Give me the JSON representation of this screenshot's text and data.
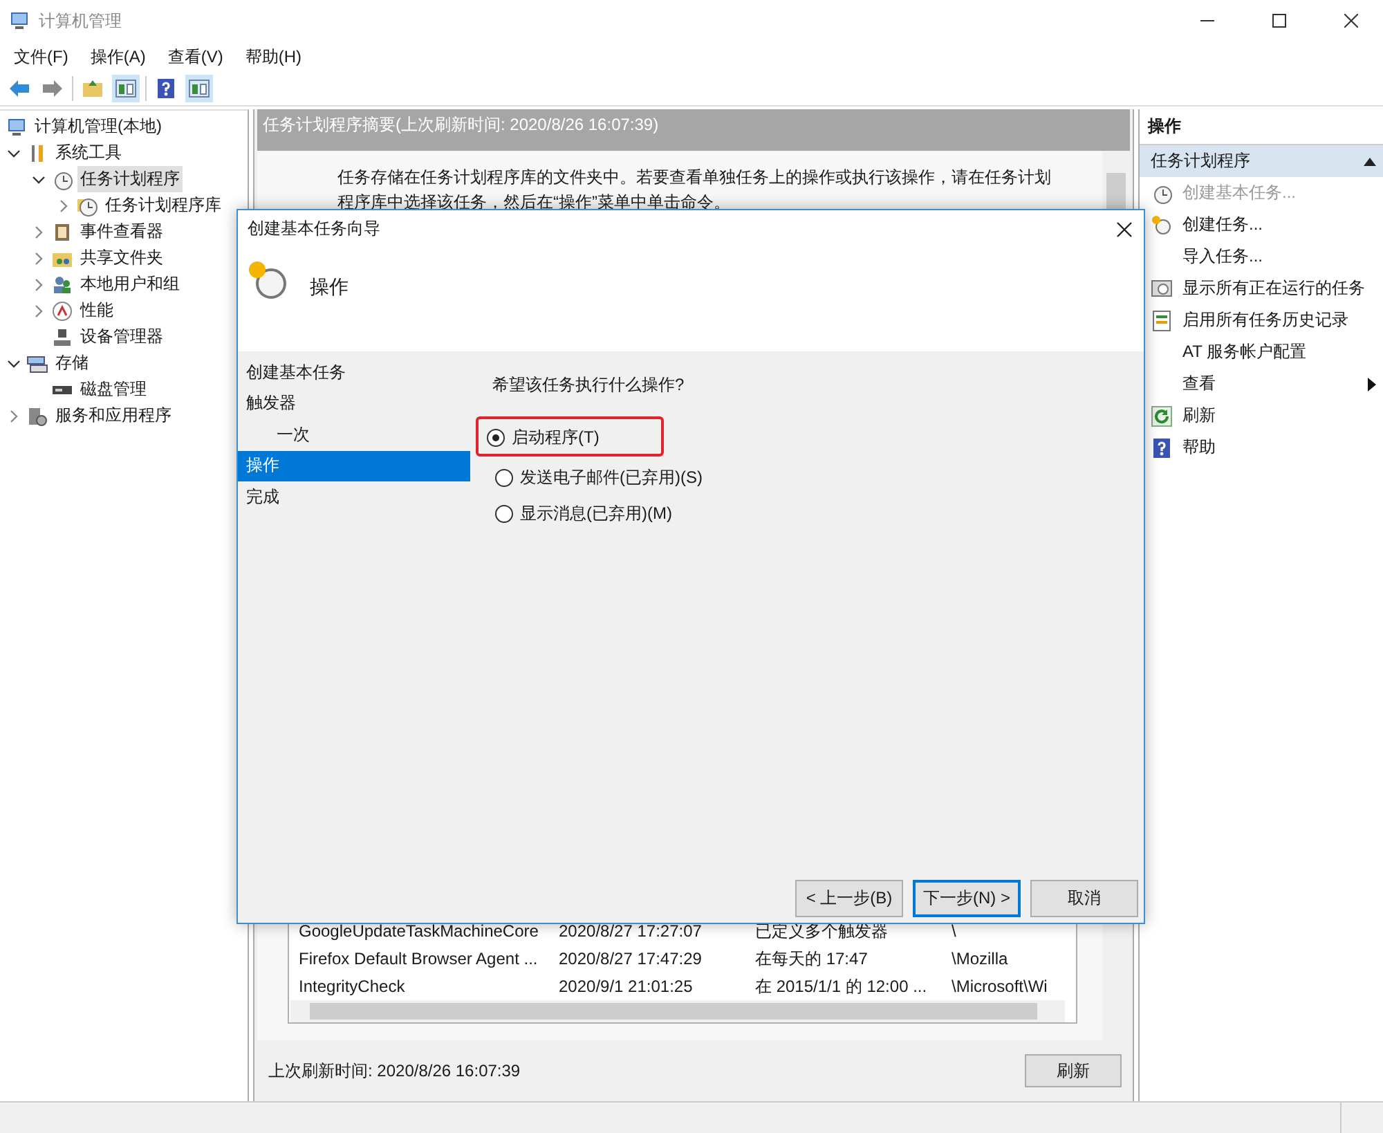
{
  "window": {
    "title": "计算机管理"
  },
  "menu": [
    "文件(F)",
    "操作(A)",
    "查看(V)",
    "帮助(H)"
  ],
  "tree": [
    {
      "label": "计算机管理(本地)",
      "selected": false,
      "children": [
        {
          "label": "系统工具",
          "selected": false,
          "expanded": true,
          "children": [
            {
              "label": "任务计划程序",
              "selected": true,
              "expanded": true,
              "children": [
                {
                  "label": "任务计划程序库",
                  "selected": false,
                  "expanded": false
                }
              ]
            },
            {
              "label": "事件查看器",
              "selected": false,
              "expanded": false
            },
            {
              "label": "共享文件夹",
              "selected": false,
              "expanded": false
            },
            {
              "label": "本地用户和组",
              "selected": false,
              "expanded": false
            },
            {
              "label": "性能",
              "selected": false,
              "expanded": false
            },
            {
              "label": "设备管理器",
              "selected": false
            }
          ]
        },
        {
          "label": "存储",
          "selected": false,
          "expanded": true,
          "children": [
            {
              "label": "磁盘管理",
              "selected": false
            }
          ]
        },
        {
          "label": "服务和应用程序",
          "selected": false,
          "expanded": false
        }
      ]
    }
  ],
  "summary": {
    "title": "任务计划程序摘要(上次刷新时间: 2020/8/26 16:07:39)",
    "description": "任务存储在任务计划程序库的文件夹中。若要查看单独任务上的操作或执行该操作，请在任务计划程序库中选择该任务，然后在“操作”菜单中单击命令。",
    "rows": [
      {
        "cells": [
          "GoogleUpdateTaskMachineCore",
          "2020/8/27 17:27:07",
          "已定义多个触发器",
          "\\"
        ]
      },
      {
        "cells": [
          "Firefox Default Browser Agent ...",
          "2020/8/27 17:47:29",
          "在每天的 17:47",
          "\\Mozilla"
        ]
      },
      {
        "cells": [
          "IntegrityCheck",
          "2020/9/1 21:01:25",
          "在 2015/1/1 的 12:00 ...",
          "\\Microsoft\\Wi"
        ]
      }
    ],
    "footer": "上次刷新时间: 2020/8/26 16:07:39",
    "refresh": "刷新"
  },
  "actions": {
    "title": "操作",
    "section": "任务计划程序",
    "expanded": true,
    "items": [
      {
        "label": "创建基本任务...",
        "disabled": true,
        "submenu": false
      },
      {
        "label": "创建任务...",
        "disabled": false,
        "submenu": false
      },
      {
        "label": "导入任务...",
        "disabled": false,
        "submenu": false
      },
      {
        "label": "显示所有正在运行的任务",
        "disabled": false,
        "submenu": false
      },
      {
        "label": "启用所有任务历史记录",
        "disabled": false,
        "submenu": false
      },
      {
        "label": "AT 服务帐户配置",
        "disabled": false,
        "submenu": false
      },
      {
        "label": "查看",
        "disabled": false,
        "submenu": true
      },
      {
        "label": "刷新",
        "disabled": false,
        "submenu": false
      },
      {
        "label": "帮助",
        "disabled": false,
        "submenu": false
      }
    ]
  },
  "dialog": {
    "title": "创建基本任务向导",
    "heading": "操作",
    "steps": [
      {
        "label": "创建基本任务",
        "selected": false
      },
      {
        "label": "触发器",
        "selected": false,
        "children": [
          {
            "label": "一次",
            "selected": false
          }
        ]
      },
      {
        "label": "操作",
        "selected": true
      },
      {
        "label": "完成",
        "selected": false
      }
    ],
    "question": "希望该任务执行什么操作?",
    "options": [
      {
        "label": "启动程序(T)",
        "selected": true,
        "highlighted": true
      },
      {
        "label": "发送电子邮件(已弃用)(S)",
        "selected": false,
        "highlighted": false
      },
      {
        "label": "显示消息(已弃用)(M)",
        "selected": false,
        "highlighted": false
      }
    ],
    "buttons": [
      {
        "label": "< 上一步(B)",
        "default": false
      },
      {
        "label": "下一步(N) >",
        "default": true
      },
      {
        "label": "取消",
        "default": false
      }
    ]
  }
}
